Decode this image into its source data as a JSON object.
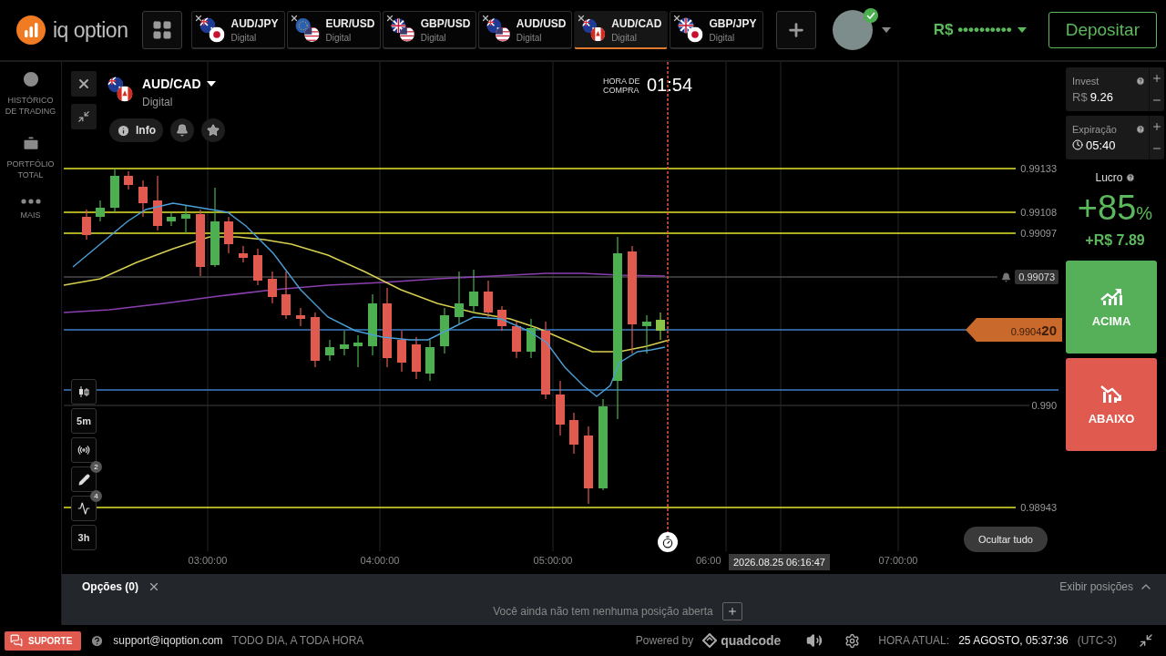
{
  "top_bar": {
    "logo": "iq option",
    "tabs": [
      {
        "pair": "AUD/JPY",
        "type": "Digital",
        "selected": false
      },
      {
        "pair": "EUR/USD",
        "type": "Digital",
        "selected": false
      },
      {
        "pair": "GBP/USD",
        "type": "Digital",
        "selected": false
      },
      {
        "pair": "AUD/USD",
        "type": "Digital",
        "selected": false
      },
      {
        "pair": "AUD/CAD",
        "type": "Digital",
        "selected": true
      },
      {
        "pair": "GBP/JPY",
        "type": "Digital",
        "selected": false
      }
    ],
    "balance": "R$ ••••••••••",
    "deposit_button": "Depositar"
  },
  "sidebar": {
    "items": [
      {
        "label": "HISTÓRICO DE TRADING",
        "kind": "history"
      },
      {
        "label": "PORTFÓLIO TOTAL",
        "kind": "portfolio"
      },
      {
        "label": "MAIS",
        "kind": "more"
      }
    ]
  },
  "chart": {
    "asset": "AUD/CAD",
    "asset_type": "Digital",
    "info_button": "Info",
    "purchase_time": {
      "label": "HORA DE COMPRA",
      "time": "01:54"
    },
    "tools": [
      {
        "kind": "chart-type"
      },
      {
        "kind": "period",
        "label": "5m"
      },
      {
        "kind": "indicators"
      },
      {
        "kind": "drawing",
        "badge": "2"
      },
      {
        "kind": "studies",
        "badge": "4"
      },
      {
        "kind": "period",
        "label": "3h"
      }
    ],
    "price_lines": [
      {
        "label": "0.99133",
        "kind": "level"
      },
      {
        "label": "0.99108",
        "kind": "level"
      },
      {
        "label": "0.99097",
        "kind": "level"
      },
      {
        "label": "0.99073",
        "kind": "alert"
      },
      {
        "label": "0.9904**20**",
        "kind": "current"
      },
      {
        "label": "0.990",
        "kind": "grid"
      },
      {
        "label": "0.98943",
        "kind": "level"
      }
    ],
    "time_axis": [
      "03:00:00",
      "04:00:00",
      "05:00:00",
      "06:00",
      "07:00:00"
    ],
    "crosshair_time": "2026.08.25 06:16:47",
    "hide_all_button": "Ocultar tudo"
  },
  "trade_panel": {
    "invest": {
      "label": "Invest",
      "currency": "R$",
      "value": "9.26"
    },
    "expiration": {
      "label": "Expiração",
      "value": "05:40"
    },
    "profit": {
      "label": "Lucro",
      "percent": "+85",
      "percent_sign": "%",
      "amount": "+R$ 7.89"
    },
    "up_button": "ACIMA",
    "down_button": "ABAIXO"
  },
  "positions": {
    "tab": "Opções (0)",
    "empty_message": "Você ainda não tem nenhuma posição aberta",
    "toggle": "Exibir posições"
  },
  "footer": {
    "support_button": "SUPORTE",
    "email": "support@iqoption.com",
    "hours": "TODO DIA, A TODA HORA",
    "powered_by": "Powered by",
    "brand": "quadcode",
    "clock_label": "HORA ATUAL:",
    "clock_value": "25 AGOSTO, 05:37:36",
    "timezone": "(UTC-3)"
  }
}
